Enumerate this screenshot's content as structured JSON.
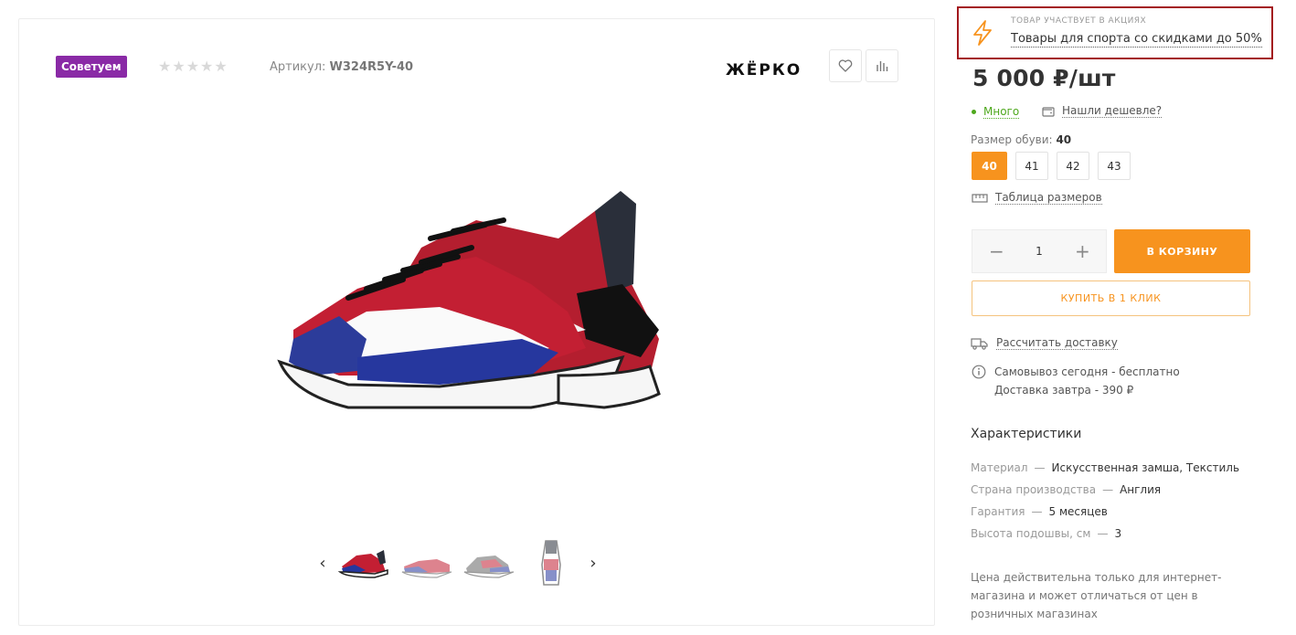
{
  "gallery": {
    "badge": "Советуем",
    "stars": "★★★★★",
    "article_label": "Артикул:",
    "article_value": "W324R5Y-40",
    "brand": "ЖЁРКО",
    "prev_arrow": "‹",
    "next_arrow": "›"
  },
  "promo": {
    "kicker": "ТОВАР УЧАСТВУЕТ В АКЦИЯХ",
    "link": "Товары для спорта со скидками до 50%"
  },
  "product": {
    "price": "5 000 ₽/шт",
    "stock": "Много",
    "cheaper": "Нашли дешевле?",
    "size_label": "Размер обуви:",
    "size_selected": "40",
    "sizes": [
      "40",
      "41",
      "42",
      "43"
    ],
    "size_table": "Таблица размеров",
    "qty_minus": "−",
    "qty_value": "1",
    "qty_plus": "+",
    "cart_button": "В корзину",
    "oneclick_button": "Купить в 1 клик",
    "delivery_link": "Рассчитать доставку",
    "pickup": "Самовывоз сегодня - бесплатно",
    "delivery_tomorrow": "Доставка завтра - 390 ₽"
  },
  "characteristics": {
    "title": "Характеристики",
    "rows": [
      {
        "key": "Материал",
        "value": "Искусственная замша, Текстиль"
      },
      {
        "key": "Страна производства",
        "value": "Англия"
      },
      {
        "key": "Гарантия",
        "value": "5 месяцев"
      },
      {
        "key": "Высота подошвы, см",
        "value": "3"
      }
    ],
    "separator": "—"
  },
  "note": "Цена действительна только для интернет-магазина и может отличаться от цен в розничных магазинах",
  "colors": {
    "accent": "#f7931e",
    "badge": "#8a2aa6",
    "promo_border": "#a3191e",
    "stock": "#4ea81d"
  }
}
